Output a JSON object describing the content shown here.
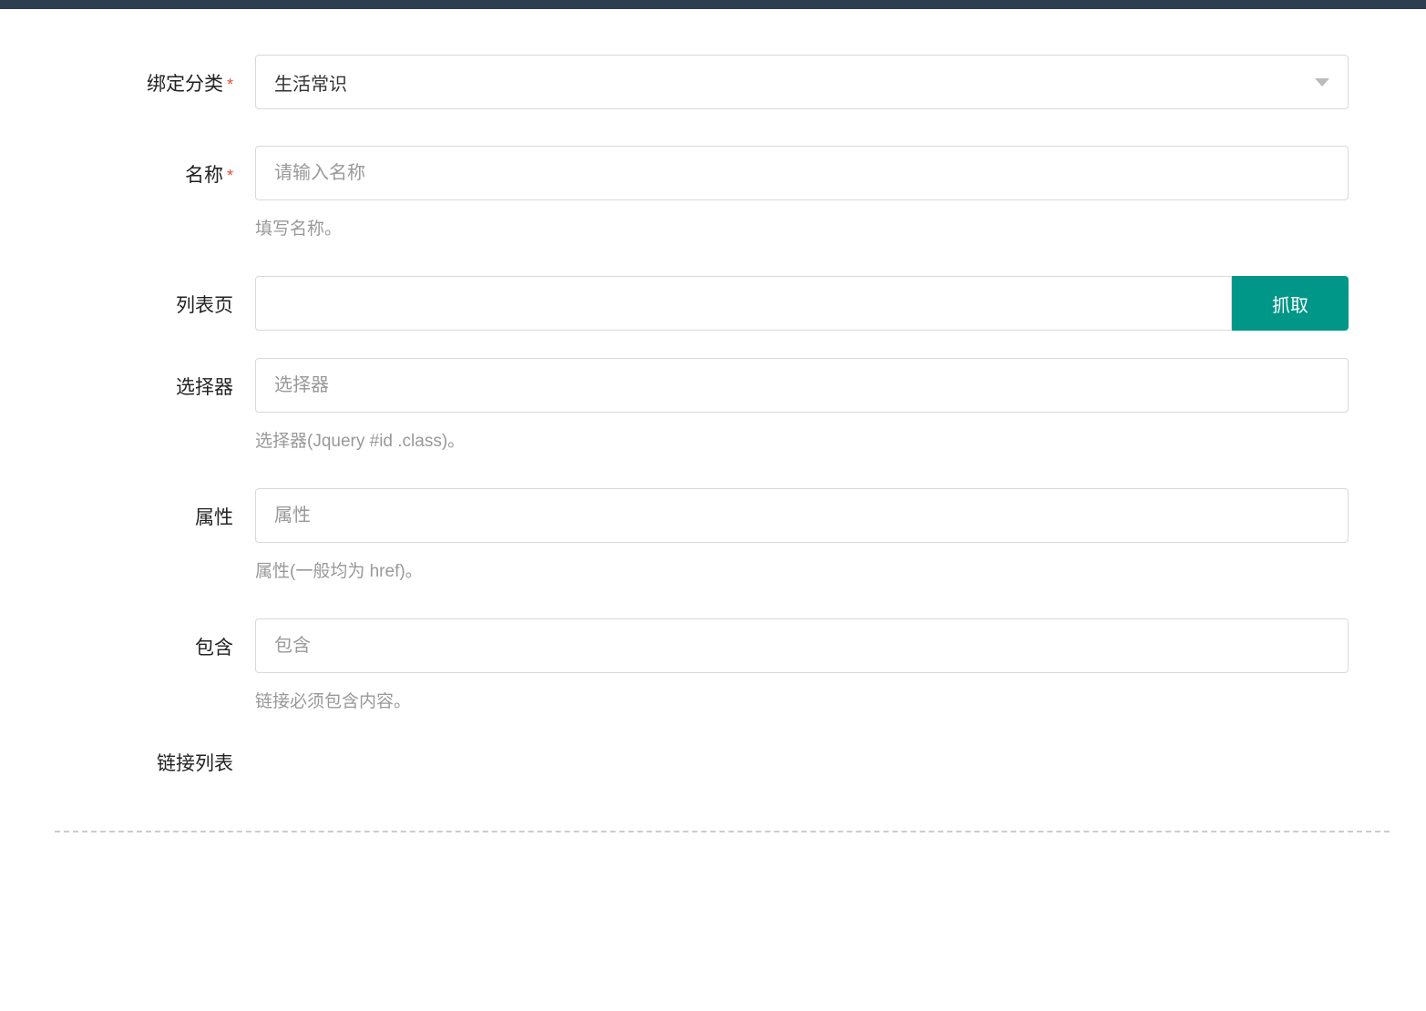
{
  "form": {
    "category": {
      "label": "绑定分类",
      "required": true,
      "value": "生活常识"
    },
    "name": {
      "label": "名称",
      "required": true,
      "placeholder": "请输入名称",
      "help": "填写名称。"
    },
    "list_page": {
      "label": "列表页",
      "button": "抓取"
    },
    "selector": {
      "label": "选择器",
      "placeholder": "选择器",
      "help": "选择器(Jquery #id .class)。"
    },
    "attribute": {
      "label": "属性",
      "placeholder": "属性",
      "help": "属性(一般均为 href)。"
    },
    "contains": {
      "label": "包含",
      "placeholder": "包含",
      "help": "链接必须包含内容。"
    },
    "link_list": {
      "label": "链接列表"
    }
  }
}
